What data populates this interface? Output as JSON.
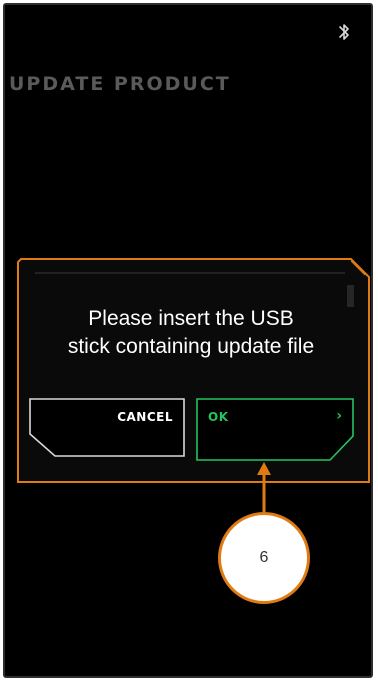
{
  "screen": {
    "title": "UPDATE PRODUCT",
    "status_icons": [
      "bluetooth-icon"
    ]
  },
  "dialog": {
    "message_line1": "Please insert the USB",
    "message_line2": "stick containing update file",
    "cancel_label": "CANCEL",
    "ok_label": "OK",
    "ok_chevron": "›"
  },
  "callout": {
    "number": "6"
  },
  "colors": {
    "accent_orange": "#e07b14",
    "ok_green": "#22c55e",
    "title_gray": "#5a5a5a",
    "background": "#000000"
  }
}
